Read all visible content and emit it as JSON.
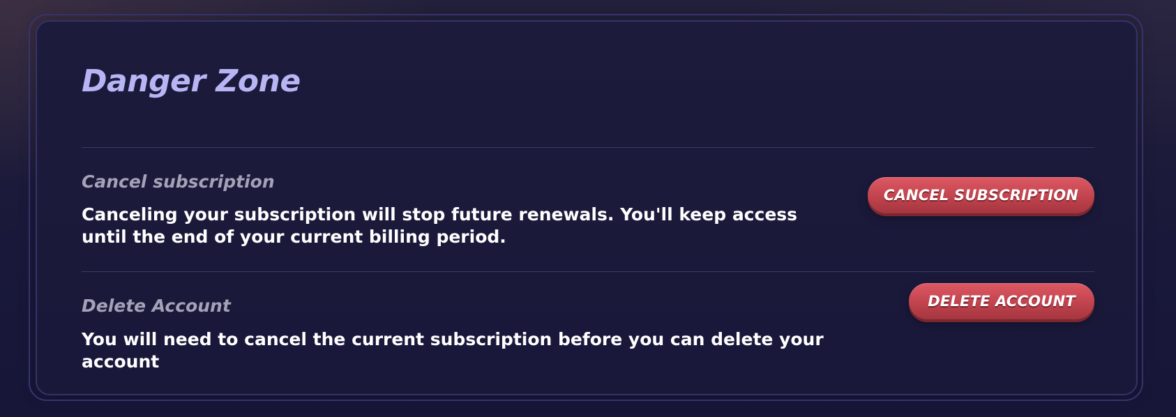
{
  "danger_zone": {
    "title": "Danger Zone",
    "accent_color": "#b8b5f5",
    "button_color": "#c94b55",
    "sections": [
      {
        "heading": "Cancel subscription",
        "description": "Canceling your subscription will stop future renewals. You'll keep access until the end of your current billing period.",
        "button_label": "CANCEL SUBSCRIPTION"
      },
      {
        "heading": "Delete Account",
        "description": "You will need to cancel the current subscription before you can delete your account",
        "button_label": "DELETE ACCOUNT"
      }
    ]
  }
}
